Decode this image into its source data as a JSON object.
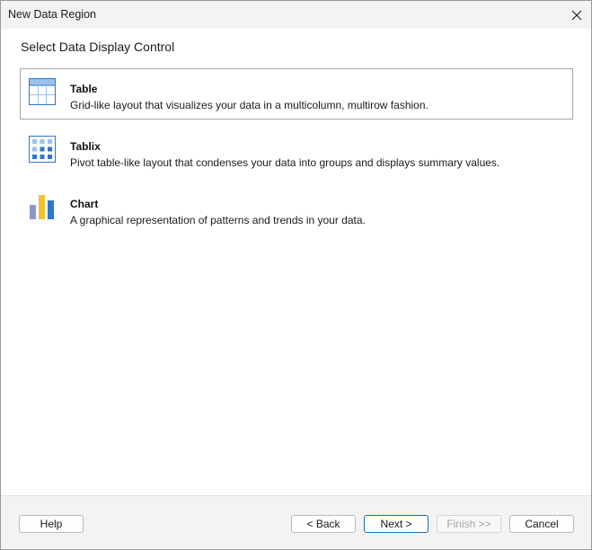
{
  "window": {
    "title": "New Data Region"
  },
  "page": {
    "heading": "Select Data Display Control"
  },
  "options": [
    {
      "title": "Table",
      "description": "Grid-like layout that visualizes your data in a multicolumn, multirow fashion.",
      "icon": "table-icon",
      "selected": true
    },
    {
      "title": "Tablix",
      "description": "Pivot table-like layout that condenses your data into groups and displays summary values.",
      "icon": "tablix-icon",
      "selected": false
    },
    {
      "title": "Chart",
      "description": "A graphical representation of patterns and trends in your data.",
      "icon": "chart-icon",
      "selected": false
    }
  ],
  "buttons": {
    "help": "Help",
    "back": "< Back",
    "next": "Next >",
    "finish": "Finish >>",
    "cancel": "Cancel"
  },
  "colors": {
    "accent_blue": "#2b78d0",
    "light_blue": "#9cc1ea",
    "chart_lavender": "#8b97cf",
    "chart_yellow": "#f2c12e",
    "selection_border": "#a5a5a5"
  }
}
